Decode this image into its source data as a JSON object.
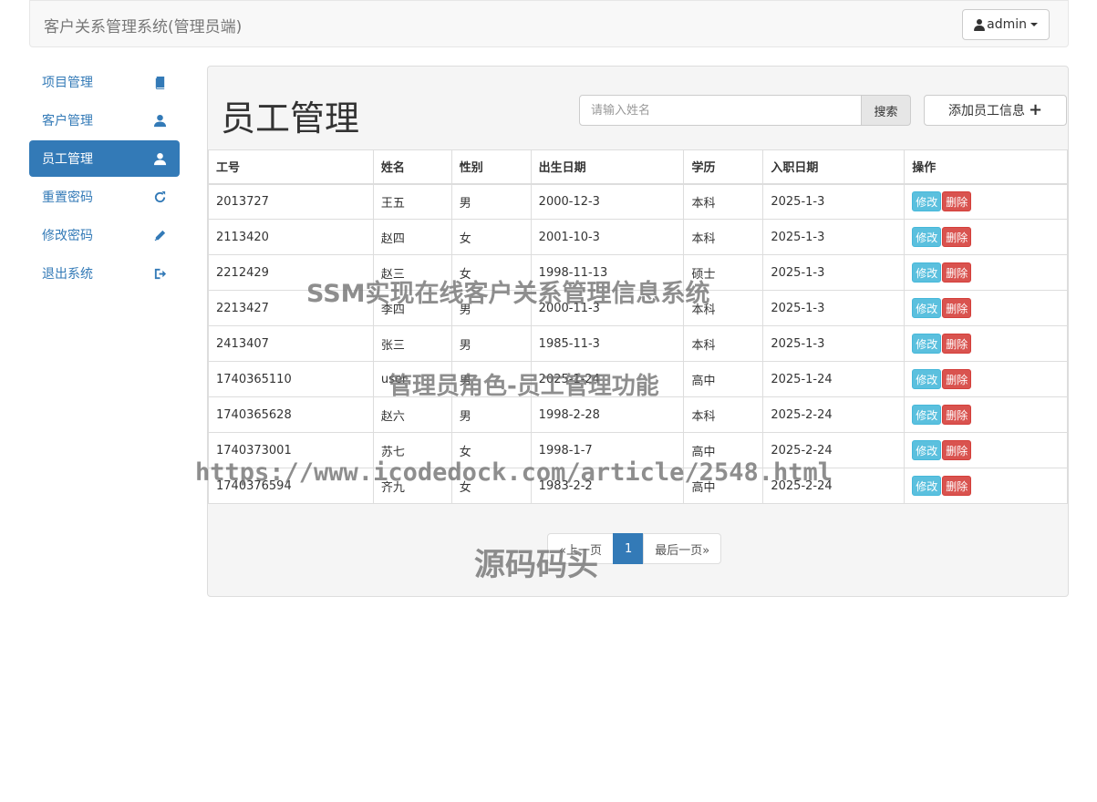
{
  "navbar": {
    "brand": "客户关系管理系统(管理员端)",
    "user_label": "admin"
  },
  "sidebar": {
    "items": [
      {
        "label": "项目管理",
        "icon": "book-icon"
      },
      {
        "label": "客户管理",
        "icon": "user-icon"
      },
      {
        "label": "员工管理",
        "icon": "user-icon"
      },
      {
        "label": "重置密码",
        "icon": "refresh-icon"
      },
      {
        "label": "修改密码",
        "icon": "pencil-icon"
      },
      {
        "label": "退出系统",
        "icon": "logout-icon"
      }
    ],
    "active_index": 2
  },
  "main": {
    "title": "员工管理",
    "search": {
      "placeholder": "请输入姓名",
      "value": "",
      "button_label": "搜索"
    },
    "add_button_label": "添加员工信息",
    "table": {
      "headers": [
        "工号",
        "姓名",
        "性别",
        "出生日期",
        "学历",
        "入职日期",
        "操作"
      ],
      "edit_label": "修改",
      "delete_label": "删除",
      "rows": [
        [
          "2013727",
          "王五",
          "男",
          "2000-12-3",
          "本科",
          "2025-1-3"
        ],
        [
          "2113420",
          "赵四",
          "女",
          "2001-10-3",
          "本科",
          "2025-1-3"
        ],
        [
          "2212429",
          "赵三",
          "女",
          "1998-11-13",
          "硕士",
          "2025-1-3"
        ],
        [
          "2213427",
          "李四",
          "男",
          "2000-11-3",
          "本科",
          "2025-1-3"
        ],
        [
          "2413407",
          "张三",
          "男",
          "1985-11-3",
          "本科",
          "2025-1-3"
        ],
        [
          "1740365110",
          "user",
          "男",
          "2025-1-24",
          "高中",
          "2025-1-24"
        ],
        [
          "1740365628",
          "赵六",
          "男",
          "1998-2-28",
          "本科",
          "2025-2-24"
        ],
        [
          "1740373001",
          "苏七",
          "女",
          "1998-1-7",
          "高中",
          "2025-2-24"
        ],
        [
          "1740376594",
          "齐九",
          "女",
          "1983-2-2",
          "高中",
          "2025-2-24"
        ]
      ]
    },
    "pagination": {
      "prev": "«上一页",
      "current": "1",
      "last": "最后一页»"
    }
  },
  "watermarks": {
    "line1": "SSM实现在线客户关系管理信息系统",
    "line2": "管理员角色-员工管理功能",
    "line3": "https://www.icodedock.com/article/2548.html",
    "line4": "源码码头"
  },
  "colors": {
    "primary": "#337ab7",
    "info": "#5bc0de",
    "danger": "#d9534f"
  }
}
